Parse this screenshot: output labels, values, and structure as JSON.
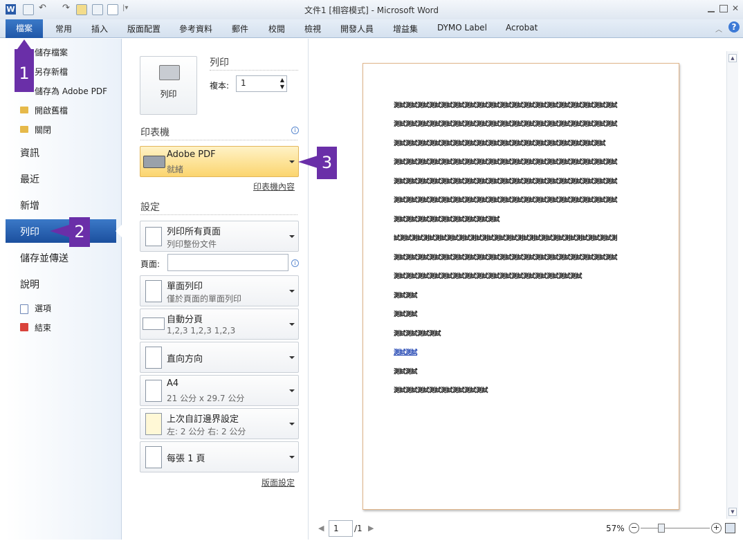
{
  "window": {
    "title": "文件1 [相容模式] - Microsoft Word"
  },
  "ribbon": {
    "tabs": [
      "檔案",
      "常用",
      "插入",
      "版面配置",
      "參考資料",
      "郵件",
      "校閱",
      "檢視",
      "開發人員",
      "增益集",
      "DYMO Label",
      "Acrobat"
    ]
  },
  "nav": {
    "small_items": [
      "儲存檔案",
      "另存新檔",
      "儲存為 Adobe PDF",
      "開啟舊檔",
      "關閉"
    ],
    "big_items": [
      "資訊",
      "最近",
      "新增",
      "列印",
      "儲存並傳送",
      "說明"
    ],
    "bottom_items": [
      "選項",
      "結束"
    ]
  },
  "print": {
    "section_title": "列印",
    "button_label": "列印",
    "copies_label": "複本:",
    "copies_value": "1",
    "printer_header": "印表機",
    "printer_name": "Adobe PDF",
    "printer_status": "就緒",
    "printer_props": "印表機內容",
    "settings_header": "設定",
    "pages_label": "頁面:",
    "page_setup": "版面設定",
    "options": [
      {
        "l1": "列印所有頁面",
        "l2": "列印整份文件"
      },
      {
        "l1": "單面列印",
        "l2": "僅於頁面的單面列印"
      },
      {
        "l1": "自動分頁",
        "l2": "1,2,3    1,2,3    1,2,3"
      },
      {
        "l1": "直向方向",
        "l2": ""
      },
      {
        "l1": "A4",
        "l2": "21 公分 x 29.7 公分"
      },
      {
        "l1": "上次自訂邊界設定",
        "l2": "左:  2 公分    右:  2 公分"
      },
      {
        "l1": "每張 1 頁",
        "l2": ""
      }
    ]
  },
  "preview": {
    "lines": [
      "測試測試測試測試測試測試測試測試測試測試測試測試測試測試測試測試測試測試測試",
      "測試測試測試測試測試測試測試測試測試測試測試測試測試測試測試測試測試測試測試",
      "測試測試測試測試測試測試測試測試測試測試測試測試測試測試測試測試測試測試",
      "測試測試測試測試測試測試測試測試測試測試測試測試測試測試測試測試測試測試測試",
      "測試測試測試測試測試測試測試測試測試測試測試測試測試測試測試測試測試測試測試",
      "測試測試測試測試測試測試測試測試測試測試測試測試測試測試測試測試測試測試測試",
      "測試測試測試測試測試測試測試測試測試",
      "試測試測試測試測試測試測試測試測試測試測試測試測試測試測試測試測試測試測試測",
      "測試測試測試測試測試測試測試測試測試測試測試測試測試測試測試測試測試測試測試",
      "測試測試測試測試測試測試測試測試測試測試測試測試測試測試測試測試",
      "測試測試",
      "測試測試",
      "測試測試測試測試",
      "測試測試",
      "測試測試",
      "測試測試測試測試測試測試測試測試"
    ],
    "page_current": "1",
    "page_total": "/1",
    "zoom": "57%"
  },
  "callouts": [
    "1",
    "2",
    "3"
  ],
  "colors": {
    "accent": "#1f57a8",
    "callout": "#6a2fa8",
    "printer_highlight": "#fbe08a"
  }
}
